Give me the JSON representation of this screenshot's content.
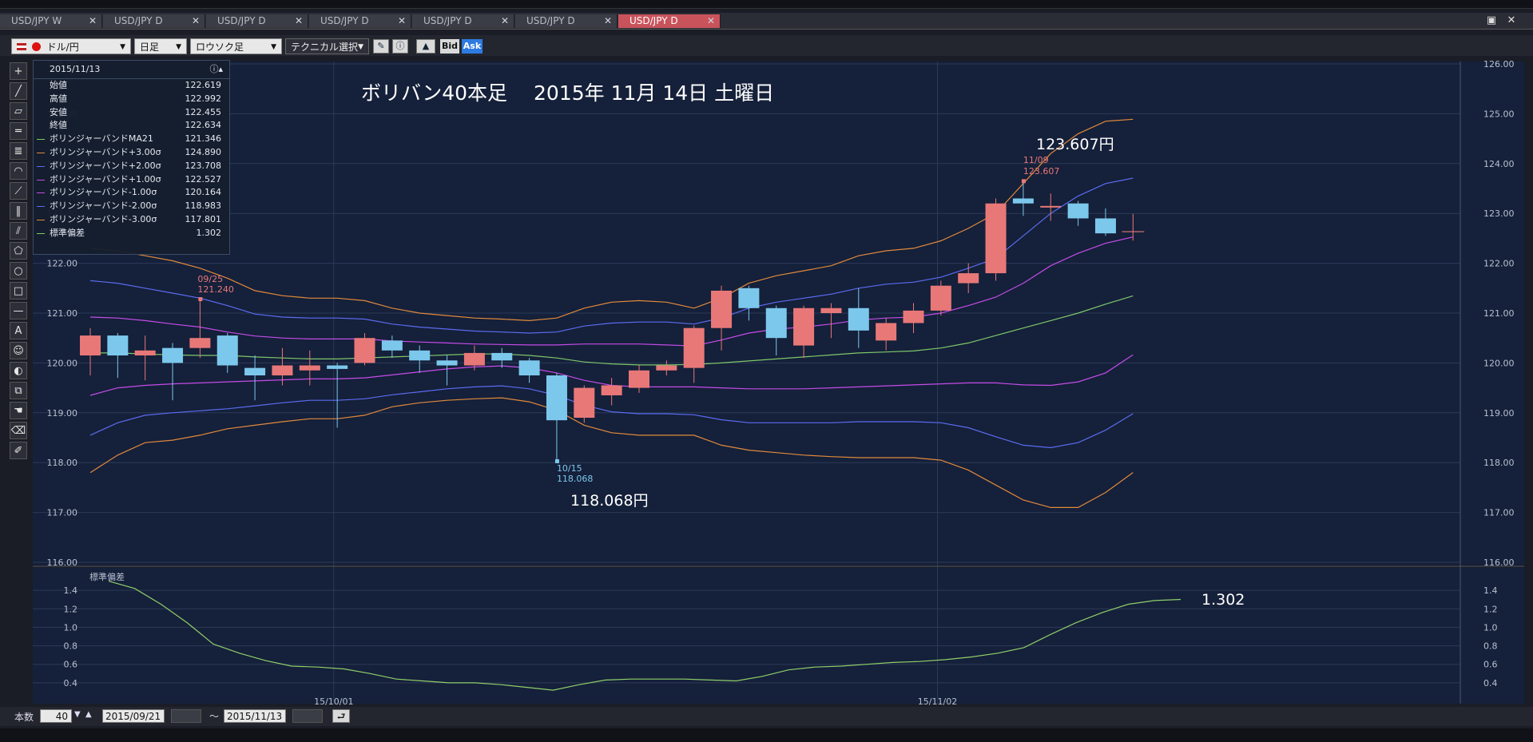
{
  "tabs": [
    {
      "label": "USD/JPY W",
      "active": false
    },
    {
      "label": "USD/JPY D",
      "active": false
    },
    {
      "label": "USD/JPY D",
      "active": false
    },
    {
      "label": "USD/JPY D",
      "active": false
    },
    {
      "label": "USD/JPY D",
      "active": false
    },
    {
      "label": "USD/JPY D",
      "active": false
    },
    {
      "label": "USD/JPY D",
      "active": true
    }
  ],
  "toolbar": {
    "pair_label": "ドル/円",
    "period_label": "日足",
    "chart_type_label": "ロウソク足",
    "technical_label": "テクニカル選択",
    "bid_label": "Bid",
    "ask_label": "Ask"
  },
  "info_panel": {
    "date": "2015/11/13",
    "rows": [
      {
        "label": "始値",
        "value": "122.619",
        "color": ""
      },
      {
        "label": "高値",
        "value": "122.992",
        "color": ""
      },
      {
        "label": "安値",
        "value": "122.455",
        "color": ""
      },
      {
        "label": "終値",
        "value": "122.634",
        "color": ""
      },
      {
        "label": "ボリンジャーバンドMA21",
        "value": "121.346",
        "color": "#7ec86a"
      },
      {
        "label": "ボリンジャーバンド+3.00σ",
        "value": "124.890",
        "color": "#e08a3c"
      },
      {
        "label": "ボリンジャーバンド+2.00σ",
        "value": "123.708",
        "color": "#5a6cf0"
      },
      {
        "label": "ボリンジャーバンド+1.00σ",
        "value": "122.527",
        "color": "#c44ce8"
      },
      {
        "label": "ボリンジャーバンド-1.00σ",
        "value": "120.164",
        "color": "#c44ce8"
      },
      {
        "label": "ボリンジャーバンド-2.00σ",
        "value": "118.983",
        "color": "#5a6cf0"
      },
      {
        "label": "ボリンジャーバンド-3.00σ",
        "value": "117.801",
        "color": "#e08a3c"
      },
      {
        "label": "標準偏差",
        "value": "1.302",
        "color": "#7ec86a"
      }
    ]
  },
  "annotations": {
    "title": "ボリバン40本足　 2015年 11月 14日 土曜日",
    "high_big": "123.607円",
    "low_big": "118.068円",
    "std_big": "1.302",
    "high_date": "11/09",
    "high_value": "123.607",
    "low_date": "10/15",
    "low_value": "118.068",
    "mark_date": "09/25",
    "mark_value": "121.240"
  },
  "bottom": {
    "count_label": "本数",
    "count_value": "40",
    "from_date": "2015/09/21",
    "range_sep": "～",
    "to_date": "2015/11/13"
  },
  "chart_data": [
    {
      "type": "candlestick",
      "title": "ボリバン40本足　 2015年 11月 14日 土曜日",
      "y_axis_ticks": [
        "126.00",
        "125.00",
        "124.00",
        "123.00",
        "122.00",
        "121.00",
        "120.00",
        "119.00",
        "118.00",
        "117.00",
        "116.00"
      ],
      "ylim": [
        116.0,
        126.0
      ],
      "x_tick_labels": [
        {
          "label": "15/10/01",
          "index": 8
        },
        {
          "label": "15/11/02",
          "index": 30
        }
      ],
      "up_color": "#e87878",
      "down_color": "#7cc8ec",
      "candles": [
        {
          "o": 120.15,
          "h": 120.7,
          "l": 119.75,
          "c": 120.55
        },
        {
          "o": 120.55,
          "h": 120.6,
          "l": 119.7,
          "c": 120.15
        },
        {
          "o": 120.15,
          "h": 120.55,
          "l": 119.65,
          "c": 120.25
        },
        {
          "o": 120.3,
          "h": 120.4,
          "l": 119.25,
          "c": 120.0
        },
        {
          "o": 120.3,
          "h": 121.24,
          "l": 120.1,
          "c": 120.5
        },
        {
          "o": 120.55,
          "h": 120.6,
          "l": 119.8,
          "c": 119.95
        },
        {
          "o": 119.9,
          "h": 120.15,
          "l": 119.25,
          "c": 119.75
        },
        {
          "o": 119.75,
          "h": 120.3,
          "l": 119.55,
          "c": 119.95
        },
        {
          "o": 119.85,
          "h": 120.25,
          "l": 119.55,
          "c": 119.95
        },
        {
          "o": 119.95,
          "h": 120.0,
          "l": 118.7,
          "c": 119.88
        },
        {
          "o": 120.0,
          "h": 120.6,
          "l": 119.95,
          "c": 120.5
        },
        {
          "o": 120.45,
          "h": 120.55,
          "l": 120.1,
          "c": 120.25
        },
        {
          "o": 120.25,
          "h": 120.35,
          "l": 119.8,
          "c": 120.05
        },
        {
          "o": 120.05,
          "h": 120.15,
          "l": 119.55,
          "c": 119.95
        },
        {
          "o": 119.95,
          "h": 120.35,
          "l": 119.85,
          "c": 120.2
        },
        {
          "o": 120.2,
          "h": 120.3,
          "l": 119.9,
          "c": 120.05
        },
        {
          "o": 120.05,
          "h": 120.1,
          "l": 119.6,
          "c": 119.75
        },
        {
          "o": 119.75,
          "h": 119.8,
          "l": 118.07,
          "c": 118.85
        },
        {
          "o": 118.9,
          "h": 119.55,
          "l": 118.8,
          "c": 119.5
        },
        {
          "o": 119.35,
          "h": 119.7,
          "l": 119.15,
          "c": 119.55
        },
        {
          "o": 119.5,
          "h": 119.95,
          "l": 119.4,
          "c": 119.85
        },
        {
          "o": 119.85,
          "h": 120.05,
          "l": 119.75,
          "c": 119.95
        },
        {
          "o": 119.9,
          "h": 120.75,
          "l": 119.6,
          "c": 120.7
        },
        {
          "o": 120.7,
          "h": 121.55,
          "l": 120.25,
          "c": 121.45
        },
        {
          "o": 121.5,
          "h": 121.55,
          "l": 120.85,
          "c": 121.1
        },
        {
          "o": 121.1,
          "h": 121.15,
          "l": 120.15,
          "c": 120.5
        },
        {
          "o": 120.35,
          "h": 121.15,
          "l": 120.1,
          "c": 121.1
        },
        {
          "o": 121.0,
          "h": 121.2,
          "l": 120.5,
          "c": 121.1
        },
        {
          "o": 121.1,
          "h": 121.5,
          "l": 120.3,
          "c": 120.65
        },
        {
          "o": 120.45,
          "h": 120.9,
          "l": 120.25,
          "c": 120.8
        },
        {
          "o": 120.8,
          "h": 121.2,
          "l": 120.6,
          "c": 121.05
        },
        {
          "o": 121.05,
          "h": 121.65,
          "l": 120.95,
          "c": 121.55
        },
        {
          "o": 121.6,
          "h": 122.0,
          "l": 121.4,
          "c": 121.8
        },
        {
          "o": 121.8,
          "h": 123.3,
          "l": 121.65,
          "c": 123.2
        },
        {
          "o": 123.3,
          "h": 123.607,
          "l": 122.95,
          "c": 123.2
        },
        {
          "o": 123.15,
          "h": 123.4,
          "l": 122.85,
          "c": 123.15
        },
        {
          "o": 123.2,
          "h": 123.25,
          "l": 122.75,
          "c": 122.9
        },
        {
          "o": 122.9,
          "h": 123.1,
          "l": 122.55,
          "c": 122.6
        },
        {
          "o": 122.619,
          "h": 122.992,
          "l": 122.455,
          "c": 122.634
        }
      ],
      "series": [
        {
          "name": "ボリンジャーバンドMA21",
          "color": "#7ec86a",
          "values": [
            120.2,
            120.2,
            120.18,
            120.16,
            120.15,
            120.15,
            120.12,
            120.1,
            120.08,
            120.08,
            120.1,
            120.12,
            120.14,
            120.16,
            120.18,
            120.18,
            120.15,
            120.1,
            120.02,
            119.98,
            119.96,
            119.96,
            119.97,
            120.0,
            120.04,
            120.08,
            120.12,
            120.16,
            120.2,
            120.22,
            120.24,
            120.3,
            120.4,
            120.55,
            120.7,
            120.85,
            121.0,
            121.18,
            121.346
          ]
        },
        {
          "name": "ボリンジャーバンド+3.00σ",
          "color": "#e08a3c",
          "values": [
            122.3,
            122.25,
            122.15,
            122.05,
            121.9,
            121.7,
            121.45,
            121.35,
            121.3,
            121.3,
            121.25,
            121.1,
            121.0,
            120.95,
            120.9,
            120.88,
            120.85,
            120.9,
            121.1,
            121.22,
            121.25,
            121.22,
            121.1,
            121.3,
            121.6,
            121.75,
            121.85,
            121.95,
            122.15,
            122.25,
            122.3,
            122.45,
            122.7,
            123.0,
            123.6,
            124.2,
            124.6,
            124.85,
            124.89
          ]
        },
        {
          "name": "ボリンジャーバンド+2.00σ",
          "color": "#5a6cf0",
          "values": [
            121.65,
            121.6,
            121.5,
            121.4,
            121.3,
            121.15,
            120.98,
            120.92,
            120.9,
            120.9,
            120.88,
            120.78,
            120.72,
            120.68,
            120.64,
            120.62,
            120.6,
            120.62,
            120.74,
            120.8,
            120.82,
            120.82,
            120.78,
            120.9,
            121.1,
            121.22,
            121.3,
            121.38,
            121.5,
            121.58,
            121.62,
            121.72,
            121.9,
            122.1,
            122.55,
            123.0,
            123.35,
            123.6,
            123.708
          ]
        },
        {
          "name": "ボリンジャーバンド+1.00σ",
          "color": "#c44ce8",
          "values": [
            120.92,
            120.9,
            120.85,
            120.78,
            120.72,
            120.62,
            120.54,
            120.5,
            120.48,
            120.48,
            120.48,
            120.44,
            120.42,
            120.4,
            120.38,
            120.37,
            120.36,
            120.36,
            120.38,
            120.38,
            120.38,
            120.36,
            120.34,
            120.46,
            120.6,
            120.68,
            120.72,
            120.78,
            120.86,
            120.9,
            120.92,
            121.0,
            121.15,
            121.32,
            121.6,
            121.95,
            122.2,
            122.4,
            122.527
          ]
        },
        {
          "name": "ボリンジャーバンド-1.00σ",
          "color": "#c44ce8",
          "values": [
            119.35,
            119.5,
            119.55,
            119.58,
            119.6,
            119.62,
            119.64,
            119.66,
            119.68,
            119.68,
            119.7,
            119.76,
            119.82,
            119.88,
            119.92,
            119.94,
            119.9,
            119.8,
            119.65,
            119.55,
            119.52,
            119.52,
            119.52,
            119.5,
            119.48,
            119.48,
            119.48,
            119.5,
            119.52,
            119.54,
            119.56,
            119.58,
            119.6,
            119.6,
            119.56,
            119.55,
            119.62,
            119.8,
            120.164
          ]
        },
        {
          "name": "ボリンジャーバンド-2.00σ",
          "color": "#5a6cf0",
          "values": [
            118.55,
            118.8,
            118.95,
            119.0,
            119.04,
            119.08,
            119.14,
            119.2,
            119.25,
            119.25,
            119.28,
            119.36,
            119.42,
            119.48,
            119.52,
            119.54,
            119.48,
            119.35,
            119.15,
            119.02,
            118.98,
            118.98,
            118.96,
            118.86,
            118.8,
            118.8,
            118.8,
            118.8,
            118.82,
            118.82,
            118.82,
            118.8,
            118.7,
            118.52,
            118.35,
            118.3,
            118.4,
            118.65,
            118.983
          ]
        },
        {
          "name": "ボリンジャーバンド-3.00σ",
          "color": "#e08a3c",
          "values": [
            117.8,
            118.15,
            118.4,
            118.45,
            118.55,
            118.68,
            118.75,
            118.82,
            118.88,
            118.88,
            118.95,
            119.12,
            119.2,
            119.25,
            119.28,
            119.3,
            119.22,
            119.05,
            118.75,
            118.6,
            118.55,
            118.55,
            118.55,
            118.35,
            118.25,
            118.2,
            118.15,
            118.12,
            118.1,
            118.1,
            118.1,
            118.05,
            117.85,
            117.55,
            117.25,
            117.1,
            117.1,
            117.4,
            117.801
          ]
        }
      ]
    },
    {
      "type": "line",
      "title": "標準偏差",
      "ylim": [
        0.2,
        1.6
      ],
      "y_axis_ticks": [
        "1.4",
        "1.2",
        "1.0",
        "0.8",
        "0.6",
        "0.4"
      ],
      "series": [
        {
          "name": "標準偏差",
          "color": "#8fcf6a",
          "values": [
            1.5,
            1.42,
            1.25,
            1.05,
            0.82,
            0.72,
            0.64,
            0.58,
            0.57,
            0.55,
            0.5,
            0.44,
            0.42,
            0.4,
            0.4,
            0.38,
            0.35,
            0.32,
            0.38,
            0.43,
            0.44,
            0.44,
            0.44,
            0.43,
            0.42,
            0.47,
            0.54,
            0.57,
            0.58,
            0.6,
            0.62,
            0.63,
            0.65,
            0.68,
            0.72,
            0.78,
            0.92,
            1.05,
            1.16,
            1.25,
            1.29,
            1.302
          ]
        }
      ]
    }
  ]
}
